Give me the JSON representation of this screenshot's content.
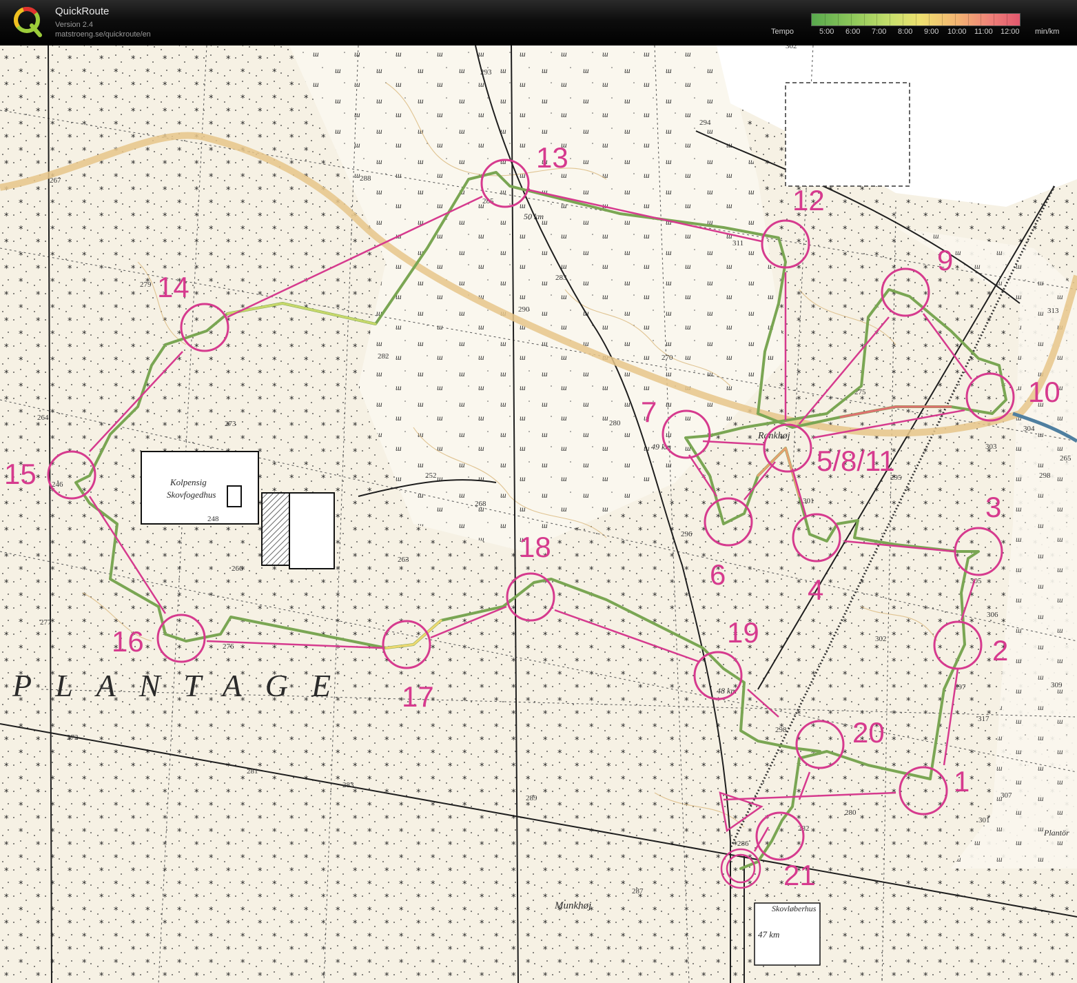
{
  "app": {
    "title": "QuickRoute",
    "version": "Version 2.4",
    "url": "matstroeng.se/quickroute/en"
  },
  "tempo_legend": {
    "label": "Tempo",
    "unit": "min/km",
    "values": [
      "5:00",
      "6:00",
      "7:00",
      "8:00",
      "9:00",
      "10:00",
      "11:00",
      "12:00"
    ],
    "colors": {
      "fast": "#58a84d",
      "mid": "#eee070",
      "slow": "#e2586e"
    }
  },
  "map": {
    "colors": {
      "course": "#d63a8e",
      "route": "#6a9a4a",
      "trail": "#e6c68a",
      "road": "#222222"
    },
    "labels": {
      "plantage": "PLANTAGE",
      "kolpensig": "Kolpensig",
      "skovfogedhus": "Skovfogedhus",
      "rankhoj": "Rankhøj",
      "munkhoj": "Munkhøj",
      "skovloberhus": "Skovløberhus",
      "plantor": "Plantör"
    },
    "km_markers": [
      "50 km",
      "49 km",
      "48 km",
      "47 km"
    ],
    "spot_heights": [
      "293",
      "302",
      "294",
      "288",
      "285",
      "311",
      "283",
      "290",
      "282",
      "279",
      "267",
      "264",
      "246",
      "273",
      "252",
      "248",
      "268",
      "266",
      "263",
      "270",
      "280",
      "275",
      "296",
      "301",
      "303",
      "306",
      "305",
      "302",
      "297",
      "298",
      "281",
      "283",
      "276",
      "277",
      "272",
      "289",
      "287",
      "280",
      "286",
      "282",
      "295",
      "304",
      "313",
      "265",
      "298",
      "309",
      "317",
      "307",
      "301"
    ],
    "controls": [
      {
        "label": "1"
      },
      {
        "label": "2"
      },
      {
        "label": "3"
      },
      {
        "label": "4"
      },
      {
        "label": "5/8/11"
      },
      {
        "label": "6"
      },
      {
        "label": "7"
      },
      {
        "label": "9"
      },
      {
        "label": "10"
      },
      {
        "label": "12"
      },
      {
        "label": "13"
      },
      {
        "label": "14"
      },
      {
        "label": "15"
      },
      {
        "label": "16"
      },
      {
        "label": "17"
      },
      {
        "label": "18"
      },
      {
        "label": "19"
      },
      {
        "label": "20"
      },
      {
        "label": "21"
      }
    ]
  }
}
